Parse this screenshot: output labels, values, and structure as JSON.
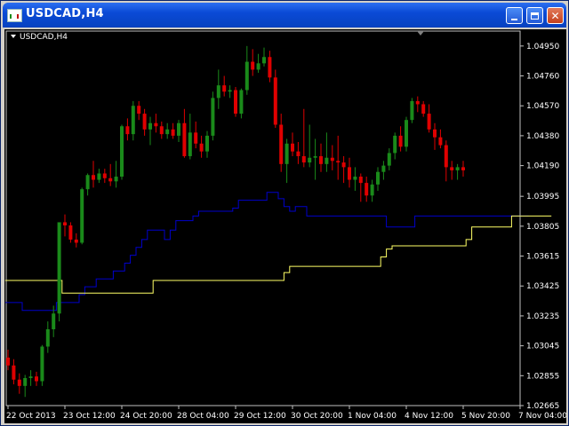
{
  "window": {
    "title": "USDCAD,H4",
    "icons": {
      "app": "terminal-chart-icon",
      "minimize": "minimize-icon",
      "maximize": "maximize-icon",
      "close": "close-icon"
    },
    "close_glyph": "✕"
  },
  "chart_data": {
    "type": "candlestick",
    "symbol_label": "USDCAD,H4",
    "colors": {
      "background": "#000000",
      "bull": "#1a8a1a",
      "bear": "#e00000",
      "frame": "#c0c0c0",
      "upper_line": "#0000cc",
      "lower_line": "#ffff66"
    },
    "y_ticks": [
      "1.04950",
      "1.04760",
      "1.04570",
      "1.04380",
      "1.04190",
      "1.03995",
      "1.03805",
      "1.03615",
      "1.03425",
      "1.03235",
      "1.03045",
      "1.02855",
      "1.02665"
    ],
    "ylim": [
      1.02665,
      1.05045
    ],
    "x_ticks": [
      {
        "label": "22 Oct 2013",
        "bar": 0
      },
      {
        "label": "23 Oct 12:00",
        "bar": 10
      },
      {
        "label": "24 Oct 20:00",
        "bar": 20
      },
      {
        "label": "28 Oct 04:00",
        "bar": 30
      },
      {
        "label": "29 Oct 12:00",
        "bar": 40
      },
      {
        "label": "30 Oct 20:00",
        "bar": 50
      },
      {
        "label": "1 Nov 04:00",
        "bar": 60
      },
      {
        "label": "4 Nov 12:00",
        "bar": 70
      },
      {
        "label": "5 Nov 20:00",
        "bar": 80
      },
      {
        "label": "7 Nov 04:00",
        "bar": 90
      }
    ],
    "candles": [
      [
        1.0297,
        1.0302,
        1.0289,
        1.0292
      ],
      [
        1.0292,
        1.0296,
        1.028,
        1.0283
      ],
      [
        1.0283,
        1.0287,
        1.0274,
        1.0279
      ],
      [
        1.0279,
        1.0286,
        1.0272,
        1.0284
      ],
      [
        1.0284,
        1.0289,
        1.0279,
        1.0285
      ],
      [
        1.0285,
        1.0288,
        1.0279,
        1.0282
      ],
      [
        1.0282,
        1.0305,
        1.0279,
        1.0304
      ],
      [
        1.0304,
        1.032,
        1.03,
        1.0315
      ],
      [
        1.0315,
        1.033,
        1.031,
        1.0325
      ],
      [
        1.0325,
        1.038,
        1.032,
        1.0383
      ],
      [
        1.0383,
        1.0388,
        1.0374,
        1.0381
      ],
      [
        1.0381,
        1.0383,
        1.037,
        1.0372
      ],
      [
        1.0372,
        1.0376,
        1.0367,
        1.037
      ],
      [
        1.037,
        1.0405,
        1.0369,
        1.0404
      ],
      [
        1.0404,
        1.0414,
        1.04,
        1.0413
      ],
      [
        1.0413,
        1.0422,
        1.0405,
        1.041
      ],
      [
        1.041,
        1.0417,
        1.0408,
        1.0414
      ],
      [
        1.0414,
        1.0417,
        1.0408,
        1.0411
      ],
      [
        1.0411,
        1.042,
        1.0406,
        1.0409
      ],
      [
        1.0409,
        1.0422,
        1.0405,
        1.0412
      ],
      [
        1.0412,
        1.0445,
        1.041,
        1.0444
      ],
      [
        1.0444,
        1.0449,
        1.0435,
        1.0439
      ],
      [
        1.0439,
        1.046,
        1.0435,
        1.0457
      ],
      [
        1.0457,
        1.046,
        1.0448,
        1.0452
      ],
      [
        1.0452,
        1.0455,
        1.0438,
        1.0442
      ],
      [
        1.0442,
        1.045,
        1.0432,
        1.0446
      ],
      [
        1.0446,
        1.0452,
        1.044,
        1.0444
      ],
      [
        1.0444,
        1.0447,
        1.0436,
        1.0439
      ],
      [
        1.0439,
        1.0446,
        1.0436,
        1.0442
      ],
      [
        1.0442,
        1.0446,
        1.0436,
        1.0438
      ],
      [
        1.0438,
        1.0448,
        1.0434,
        1.0446
      ],
      [
        1.0446,
        1.0455,
        1.0424,
        1.0425
      ],
      [
        1.0425,
        1.0452,
        1.0423,
        1.044
      ],
      [
        1.044,
        1.0447,
        1.043,
        1.0433
      ],
      [
        1.0433,
        1.0438,
        1.0424,
        1.0428
      ],
      [
        1.0428,
        1.0441,
        1.0424,
        1.0438
      ],
      [
        1.0438,
        1.0466,
        1.0435,
        1.0462
      ],
      [
        1.0462,
        1.048,
        1.0455,
        1.047
      ],
      [
        1.047,
        1.0476,
        1.0463,
        1.0466
      ],
      [
        1.0466,
        1.047,
        1.0462,
        1.0467
      ],
      [
        1.0467,
        1.0469,
        1.045,
        1.0452
      ],
      [
        1.0452,
        1.0468,
        1.0449,
        1.0467
      ],
      [
        1.0467,
        1.0495,
        1.0464,
        1.0485
      ],
      [
        1.0485,
        1.0493,
        1.0476,
        1.048
      ],
      [
        1.048,
        1.049,
        1.0478,
        1.0484
      ],
      [
        1.0484,
        1.0494,
        1.0482,
        1.0488
      ],
      [
        1.0488,
        1.0492,
        1.0472,
        1.0475
      ],
      [
        1.0475,
        1.048,
        1.0443,
        1.0445
      ],
      [
        1.0445,
        1.0452,
        1.0415,
        1.042
      ],
      [
        1.042,
        1.0436,
        1.0408,
        1.0433
      ],
      [
        1.0433,
        1.044,
        1.0425,
        1.0428
      ],
      [
        1.0428,
        1.0434,
        1.042,
        1.0425
      ],
      [
        1.0425,
        1.0455,
        1.0418,
        1.0421
      ],
      [
        1.0421,
        1.0445,
        1.0418,
        1.0424
      ],
      [
        1.0424,
        1.0436,
        1.041,
        1.0425
      ],
      [
        1.0425,
        1.0433,
        1.0415,
        1.042
      ],
      [
        1.042,
        1.044,
        1.0415,
        1.0424
      ],
      [
        1.0424,
        1.0432,
        1.0416,
        1.0422
      ],
      [
        1.0422,
        1.0438,
        1.041,
        1.0421
      ],
      [
        1.0421,
        1.0425,
        1.0408,
        1.0418
      ],
      [
        1.0418,
        1.0424,
        1.0405,
        1.041
      ],
      [
        1.041,
        1.0418,
        1.0403,
        1.0412
      ],
      [
        1.0412,
        1.0414,
        1.0396,
        1.0408
      ],
      [
        1.0408,
        1.0412,
        1.0396,
        1.04
      ],
      [
        1.04,
        1.041,
        1.0396,
        1.0407
      ],
      [
        1.0407,
        1.0418,
        1.0403,
        1.0415
      ],
      [
        1.0415,
        1.0422,
        1.041,
        1.0419
      ],
      [
        1.0419,
        1.043,
        1.0416,
        1.0427
      ],
      [
        1.0427,
        1.044,
        1.0423,
        1.0438
      ],
      [
        1.0438,
        1.0444,
        1.0428,
        1.0431
      ],
      [
        1.0431,
        1.045,
        1.0428,
        1.0448
      ],
      [
        1.0448,
        1.0462,
        1.0446,
        1.046
      ],
      [
        1.046,
        1.0463,
        1.0453,
        1.0458
      ],
      [
        1.0458,
        1.046,
        1.045,
        1.0452
      ],
      [
        1.0452,
        1.0458,
        1.044,
        1.0442
      ],
      [
        1.0442,
        1.0446,
        1.0429,
        1.0437
      ],
      [
        1.0437,
        1.0442,
        1.043,
        1.0432
      ],
      [
        1.0432,
        1.0435,
        1.0409,
        1.0418
      ],
      [
        1.0418,
        1.0422,
        1.041,
        1.0416
      ],
      [
        1.0416,
        1.042,
        1.041,
        1.0418
      ],
      [
        1.0418,
        1.0422,
        1.0412,
        1.0416
      ]
    ],
    "upper_channel": [
      1.0332,
      1.0332,
      1.0332,
      1.0327,
      1.0327,
      1.0327,
      1.0327,
      1.0327,
      1.0327,
      1.0332,
      1.0332,
      1.0332,
      1.0332,
      1.0337,
      1.0342,
      1.0342,
      1.0347,
      1.0347,
      1.0347,
      1.0352,
      1.0352,
      1.0357,
      1.0362,
      1.0367,
      1.0372,
      1.0378,
      1.0378,
      1.0378,
      1.0372,
      1.0378,
      1.0384,
      1.0384,
      1.0384,
      1.0387,
      1.039,
      1.039,
      1.039,
      1.039,
      1.039,
      1.039,
      1.0392,
      1.0397,
      1.0397,
      1.0397,
      1.0397,
      1.0397,
      1.0402,
      1.0402,
      1.0398,
      1.0393,
      1.039,
      1.0393,
      1.0393,
      1.0387,
      1.0387,
      1.0387,
      1.0387,
      1.0387,
      1.0387,
      1.0387,
      1.0387,
      1.0387,
      1.0387,
      1.0387,
      1.0387,
      1.0387,
      1.0387,
      1.038,
      1.038,
      1.038,
      1.038,
      1.038,
      1.0387,
      1.0387,
      1.0387,
      1.0387,
      1.0387,
      1.0387,
      1.0387,
      1.0387,
      1.0387,
      1.0387,
      1.0387,
      1.0387,
      1.0387,
      1.0387,
      1.0387,
      1.0387,
      1.0387,
      1.0387,
      1.0387,
      1.0387
    ],
    "lower_channel": [
      1.0346,
      1.0346,
      1.0346,
      1.0346,
      1.0346,
      1.0346,
      1.0346,
      1.0346,
      1.0346,
      1.0346,
      1.0338,
      1.0338,
      1.0338,
      1.0338,
      1.0338,
      1.0338,
      1.0338,
      1.0338,
      1.0338,
      1.0338,
      1.0338,
      1.0338,
      1.0338,
      1.0338,
      1.0338,
      1.0338,
      1.0346,
      1.0346,
      1.0346,
      1.0346,
      1.0346,
      1.0346,
      1.0346,
      1.0346,
      1.0346,
      1.0346,
      1.0346,
      1.0346,
      1.0346,
      1.0346,
      1.0346,
      1.0346,
      1.0346,
      1.0346,
      1.0346,
      1.0346,
      1.0346,
      1.0346,
      1.0346,
      1.0351,
      1.0355,
      1.0355,
      1.0355,
      1.0355,
      1.0355,
      1.0355,
      1.0355,
      1.0355,
      1.0355,
      1.0355,
      1.0355,
      1.0355,
      1.0355,
      1.0355,
      1.0355,
      1.0355,
      1.0361,
      1.0366,
      1.0368,
      1.0368,
      1.0368,
      1.0368,
      1.0368,
      1.0368,
      1.0368,
      1.0368,
      1.0368,
      1.0368,
      1.0368,
      1.0368,
      1.0368,
      1.0372,
      1.038,
      1.038,
      1.038,
      1.038,
      1.038,
      1.038,
      1.038,
      1.0387,
      1.0387,
      1.0387,
      1.0387,
      1.0387,
      1.0387,
      1.0387
    ]
  }
}
